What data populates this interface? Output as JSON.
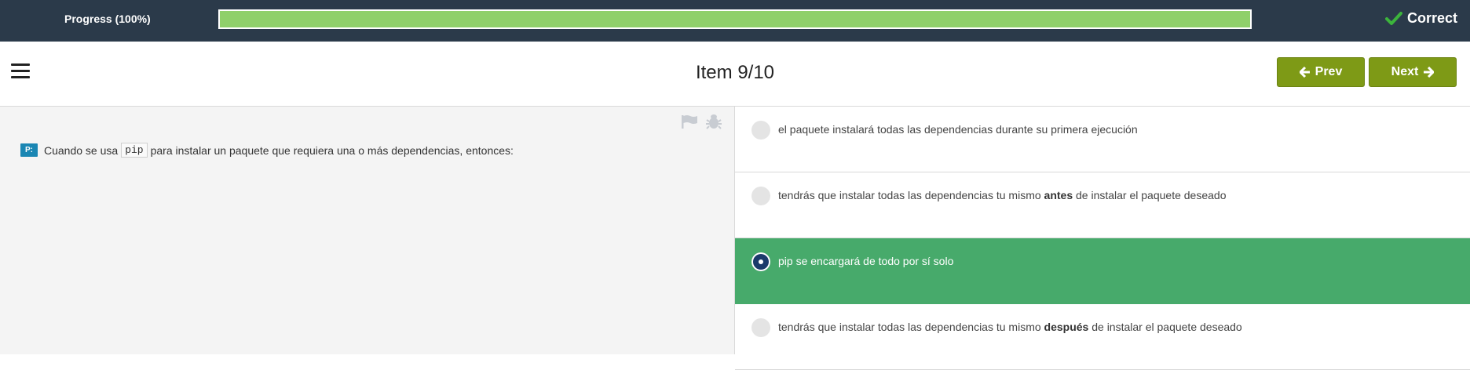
{
  "topbar": {
    "progress_label": "Progress (100%)",
    "progress_value": 1.0,
    "status": "Correct",
    "colors": {
      "bar_bg": "#2b3a4a",
      "progress_fill": "#8fd06a",
      "check": "#3cb43c"
    }
  },
  "header": {
    "title": "Item 9/10",
    "prev_label": "Prev",
    "next_label": "Next",
    "icons": [
      "menu-icon",
      "arrow-left-icon",
      "arrow-right-icon"
    ],
    "button_color": "#7e9a16"
  },
  "question": {
    "badge": "P:",
    "text_before": "Cuando se usa",
    "code": "pip",
    "text_after": "para instalar un paquete que requiera una o más dependencias, entonces:",
    "tool_icons": [
      "flag-icon",
      "bug-icon"
    ]
  },
  "options": [
    {
      "parts": [
        "el paquete instalará todas las dependencias durante su primera ejecución"
      ],
      "selected": false
    },
    {
      "parts": [
        "tendrás que instalar todas las dependencias tu mismo ",
        "antes",
        " de instalar el paquete deseado"
      ],
      "selected": false
    },
    {
      "parts": [
        "pip se encargará de todo por sí solo"
      ],
      "selected": true
    },
    {
      "parts": [
        "tendrás que instalar todas las dependencias tu mismo ",
        "después",
        " de instalar el paquete deseado"
      ],
      "selected": false
    }
  ],
  "selected_color": "#47aa6b"
}
